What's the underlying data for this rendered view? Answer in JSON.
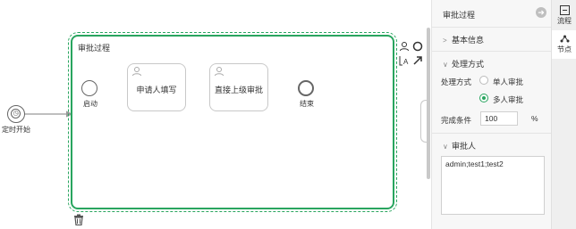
{
  "canvas": {
    "subprocess_title": "审批过程",
    "timer_start_label": "定时开始",
    "start_label": "启动",
    "task1_label": "申请人填写",
    "task2_label": "直接上级审批",
    "end_label": "结束",
    "accent_color": "#29a55f"
  },
  "panel": {
    "title": "审批过程",
    "basic_info": "基本信息",
    "process_mode_section": "处理方式",
    "process_mode_label": "处理方式",
    "option_single": "单人审批",
    "option_multi": "多人审批",
    "selected_option": "多人审批",
    "completion_label": "完成条件",
    "completion_value": "100",
    "completion_unit": "%",
    "approver_section": "审批人",
    "approver_value": "admin;test1;test2"
  },
  "rail": {
    "tab_flow": "流程",
    "tab_node": "节点"
  },
  "icons": [
    "timer-icon",
    "user-icon",
    "trash-icon",
    "collapse-arrow-icon",
    "flow-icon",
    "node-icon",
    "chevron-right-icon",
    "chevron-down-icon"
  ]
}
